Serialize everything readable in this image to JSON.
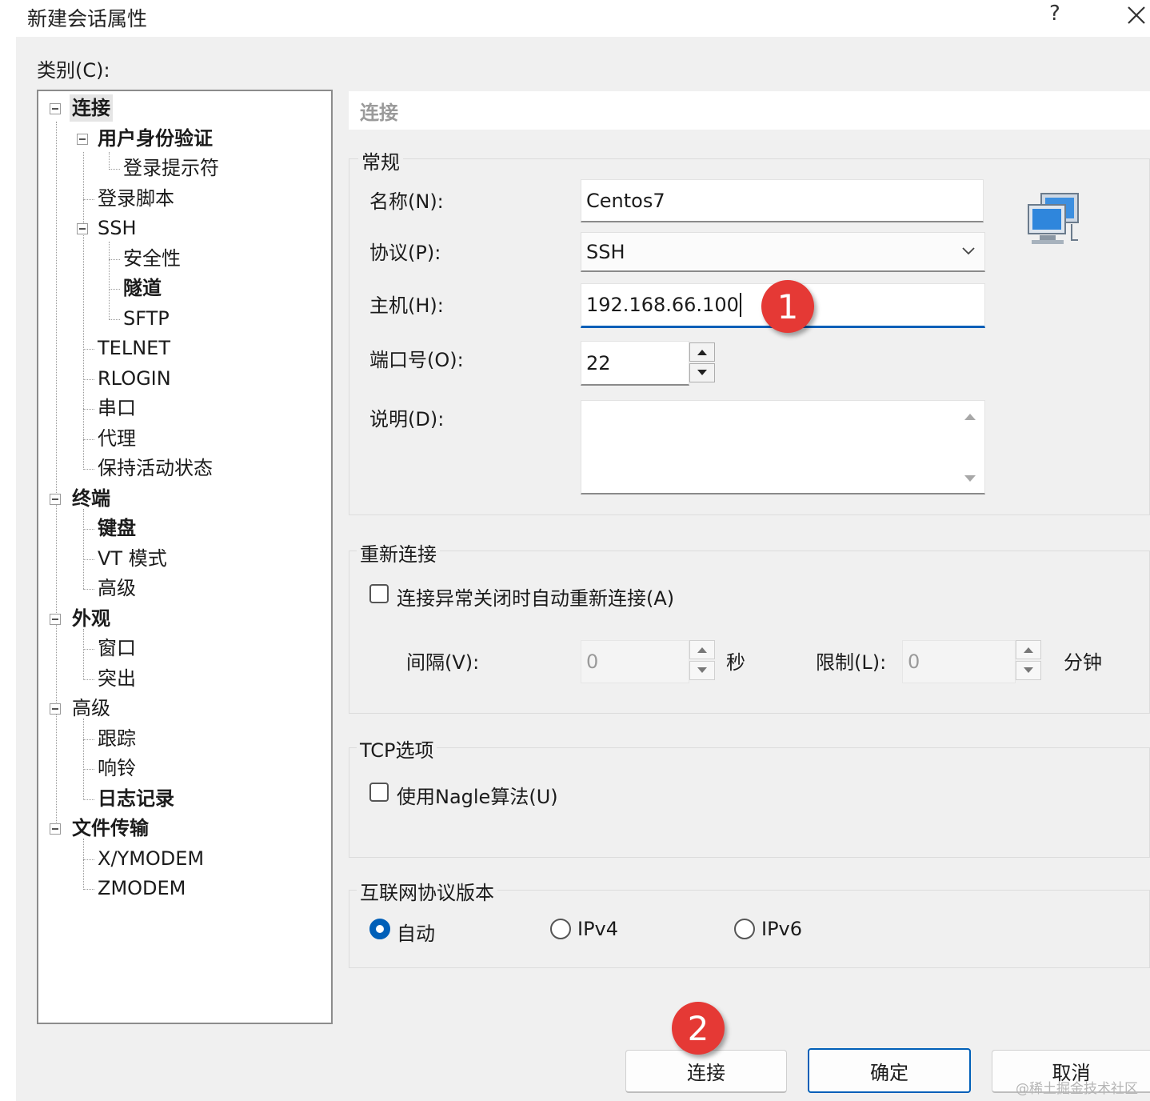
{
  "window": {
    "title": "新建会话属性",
    "help_symbol": "?",
    "close_icon": "close-icon"
  },
  "category_label": "类别(C):",
  "tree": [
    {
      "label": "连接",
      "level": 0,
      "bold": true,
      "selected": true,
      "expanded": true
    },
    {
      "label": "用户身份验证",
      "level": 1,
      "bold": true,
      "expanded": true
    },
    {
      "label": "登录提示符",
      "level": 2,
      "bold": false
    },
    {
      "label": "登录脚本",
      "level": 1,
      "bold": false
    },
    {
      "label": "SSH",
      "level": 1,
      "bold": false,
      "expanded": true
    },
    {
      "label": "安全性",
      "level": 2,
      "bold": false
    },
    {
      "label": "隧道",
      "level": 2,
      "bold": true
    },
    {
      "label": "SFTP",
      "level": 2,
      "bold": false
    },
    {
      "label": "TELNET",
      "level": 1,
      "bold": false
    },
    {
      "label": "RLOGIN",
      "level": 1,
      "bold": false
    },
    {
      "label": "串口",
      "level": 1,
      "bold": false
    },
    {
      "label": "代理",
      "level": 1,
      "bold": false
    },
    {
      "label": "保持活动状态",
      "level": 1,
      "bold": false
    },
    {
      "label": "终端",
      "level": 0,
      "bold": true,
      "expanded": true
    },
    {
      "label": "键盘",
      "level": 1,
      "bold": true
    },
    {
      "label": "VT 模式",
      "level": 1,
      "bold": false
    },
    {
      "label": "高级",
      "level": 1,
      "bold": false
    },
    {
      "label": "外观",
      "level": 0,
      "bold": true,
      "expanded": true
    },
    {
      "label": "窗口",
      "level": 1,
      "bold": false
    },
    {
      "label": "突出",
      "level": 1,
      "bold": false
    },
    {
      "label": "高级",
      "level": 0,
      "bold": false,
      "expanded": true
    },
    {
      "label": "跟踪",
      "level": 1,
      "bold": false
    },
    {
      "label": "响铃",
      "level": 1,
      "bold": false
    },
    {
      "label": "日志记录",
      "level": 1,
      "bold": true
    },
    {
      "label": "文件传输",
      "level": 0,
      "bold": true,
      "expanded": true
    },
    {
      "label": "X/YMODEM",
      "level": 1,
      "bold": false
    },
    {
      "label": "ZMODEM",
      "level": 1,
      "bold": false
    }
  ],
  "panel": {
    "header": "连接",
    "general": {
      "title": "常规",
      "name_label": "名称(N):",
      "name_value": "Centos7",
      "protocol_label": "协议(P):",
      "protocol_value": "SSH",
      "host_label": "主机(H):",
      "host_value": "192.168.66.100",
      "port_label": "端口号(O):",
      "port_value": "22",
      "desc_label": "说明(D):",
      "desc_value": "",
      "icon": "network-computers-icon"
    },
    "reconnect": {
      "title": "重新连接",
      "checkbox_label": "连接异常关闭时自动重新连接(A)",
      "checked": false,
      "interval_label": "间隔(V):",
      "interval_value": "0",
      "interval_unit": "秒",
      "limit_label": "限制(L):",
      "limit_value": "0",
      "limit_unit": "分钟"
    },
    "tcp": {
      "title": "TCP选项",
      "nagle_label": "使用Nagle算法(U)",
      "checked": false
    },
    "ip_version": {
      "title": "互联网协议版本",
      "options": [
        "自动",
        "IPv4",
        "IPv6"
      ],
      "selected": "自动"
    }
  },
  "buttons": {
    "connect": "连接",
    "ok": "确定",
    "cancel": "取消"
  },
  "annotations": {
    "badge1": "1",
    "badge2": "2"
  },
  "watermark": "@稀土掘金技术社区",
  "colors": {
    "accent": "#005fb8",
    "badge": "#e53935",
    "dialog_bg": "#f0f0f0"
  }
}
